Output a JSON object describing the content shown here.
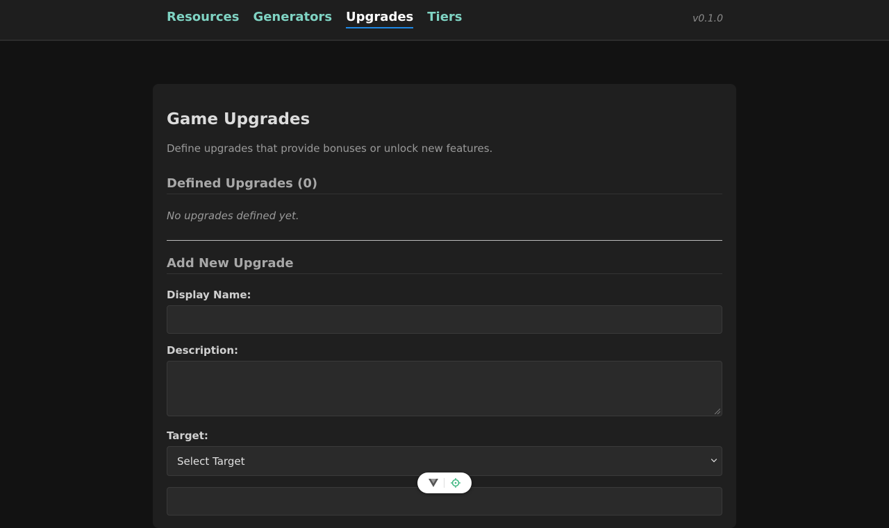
{
  "nav": {
    "tabs": [
      {
        "label": "Resources"
      },
      {
        "label": "Generators"
      },
      {
        "label": "Upgrades",
        "active": true
      },
      {
        "label": "Tiers"
      }
    ],
    "version": "v0.1.0"
  },
  "page": {
    "title": "Game Upgrades",
    "description": "Define upgrades that provide bonuses or unlock new features."
  },
  "defined": {
    "title": "Defined Upgrades (0)",
    "empty_message": "No upgrades defined yet."
  },
  "form": {
    "title": "Add New Upgrade",
    "display_name_label": "Display Name:",
    "display_name_value": "",
    "description_label": "Description:",
    "description_value": "",
    "target_label": "Target:",
    "target_selected": "Select Target"
  },
  "colors": {
    "background": "#121212",
    "panel": "#1f1f1f",
    "nav_link": "#7fd3c3",
    "active_underline": "#1e88e5"
  },
  "icons": {
    "devtools_left": "vue-logo-icon",
    "devtools_right": "target-icon"
  }
}
